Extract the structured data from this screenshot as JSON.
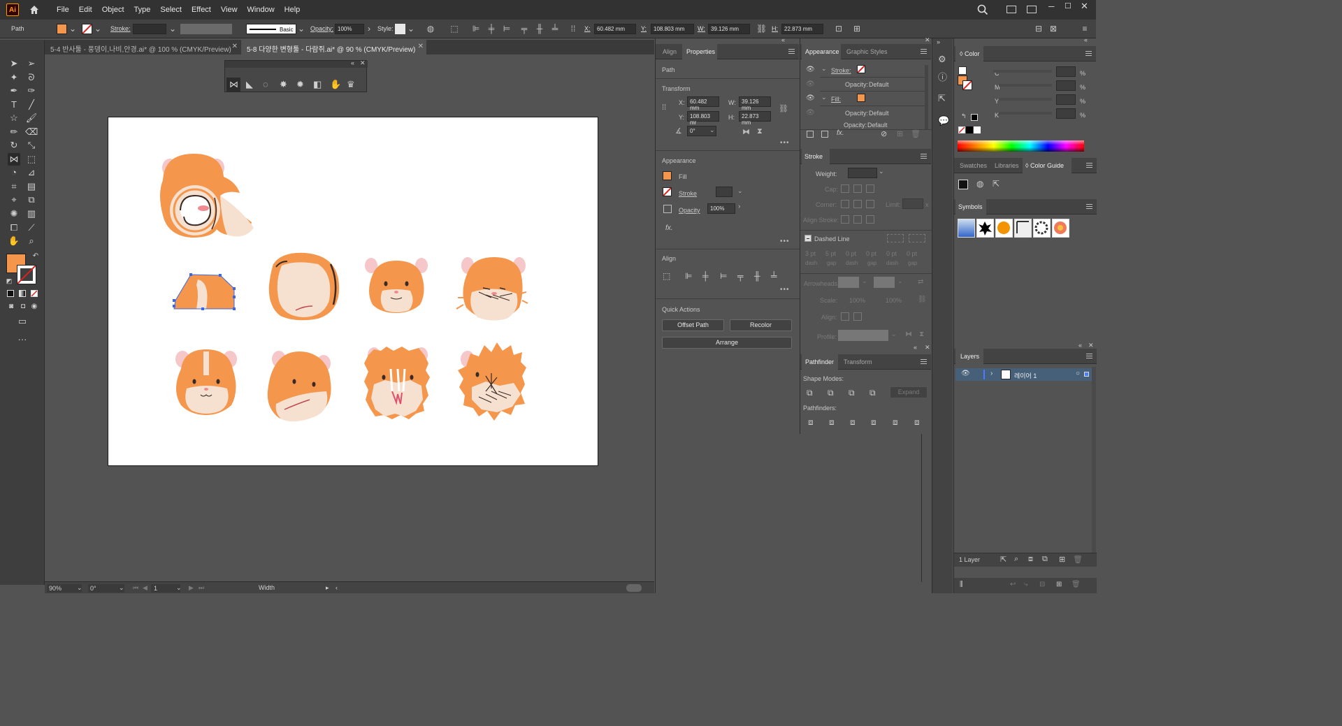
{
  "app": {
    "logo": "Ai"
  },
  "menu": [
    "File",
    "Edit",
    "Object",
    "Type",
    "Select",
    "Effect",
    "View",
    "Window",
    "Help"
  ],
  "control_bar": {
    "selection_type": "Path",
    "stroke_label": "Stroke:",
    "brush_label": "Basic",
    "opacity_label": "Opacity:",
    "opacity_value": "100%",
    "style_label": "Style:",
    "x_label": "X:",
    "x_value": "60.482 mm",
    "y_label": "Y:",
    "y_value": "108.803 mm",
    "w_label": "W:",
    "w_value": "39.126 mm",
    "h_label": "H:",
    "h_value": "22.873 mm"
  },
  "doc_tabs": [
    {
      "label": "5-4 반사툴 - 풍뎅이,나비,안경.ai* @ 100 % (CMYK/Preview)",
      "active": false
    },
    {
      "label": "5-8 다양한 변형툴 - 다람쥐.ai* @ 90 % (CMYK/Preview)",
      "active": true
    }
  ],
  "status_bar": {
    "zoom": "90%",
    "rotation": "0°",
    "artboard": "1",
    "tool_name": "Width"
  },
  "properties_panel": {
    "tabs": [
      "Align",
      "Properties"
    ],
    "section_path": "Path",
    "section_transform": "Transform",
    "x_label": "X:",
    "x_value": "60.482 mm",
    "y_label": "Y:",
    "y_value": "108.803 mr",
    "w_label": "W:",
    "w_value": "39.126 mm",
    "h_label": "H:",
    "h_value": "22.873 mm",
    "angle_value": "0°",
    "section_appearance": "Appearance",
    "fill_label": "Fill",
    "stroke_label": "Stroke",
    "opacity_label": "Opacity",
    "opacity_value": "100%",
    "fx_label": "fx.",
    "section_align": "Align",
    "section_quick_actions": "Quick Actions",
    "offset_path": "Offset Path",
    "recolor": "Recolor",
    "arrange": "Arrange"
  },
  "appearance_panel": {
    "tabs": [
      "Appearance",
      "Graphic Styles"
    ],
    "rows": [
      {
        "label": "Stroke:",
        "value": ""
      },
      {
        "label": "Opacity:",
        "value": "Default"
      },
      {
        "label": "Fill:",
        "value": ""
      },
      {
        "label": "Opacity:",
        "value": "Default"
      },
      {
        "label": "Opacity:",
        "value": "Default"
      }
    ],
    "fx_label": "fx."
  },
  "stroke_panel": {
    "title": "Stroke",
    "weight_label": "Weight:",
    "cap_label": "Cap:",
    "corner_label": "Corner:",
    "limit_label": "Limit:",
    "limit_unit": "x",
    "align_label": "Align Stroke:",
    "dashed_label": "Dashed Line",
    "dash_values": [
      "3 pt",
      "5 pt",
      "0 pt",
      "0 pt",
      "0 pt",
      "0 pt"
    ],
    "dash_labels": [
      "dash",
      "gap",
      "dash",
      "gap",
      "dash",
      "gap"
    ],
    "arrowheads_label": "Arrowheads:",
    "scale_label": "Scale:",
    "scale_values": [
      "100%",
      "100%"
    ],
    "align2_label": "Align:",
    "profile_label": "Profile:"
  },
  "pathfinder_panel": {
    "tabs": [
      "Pathfinder",
      "Transform"
    ],
    "shape_modes": "Shape Modes:",
    "expand": "Expand",
    "pathfinders": "Pathfinders:"
  },
  "color_panel": {
    "title": "Color",
    "channels": [
      "C",
      "M",
      "Y",
      "K"
    ],
    "unit": "%"
  },
  "swatches_panel": {
    "tabs": [
      "Swatches",
      "Libraries",
      "Color Guide"
    ]
  },
  "symbols_panel": {
    "title": "Symbols"
  },
  "layers_panel": {
    "title": "Layers",
    "layer_name": "레이어 1",
    "count": "1 Layer"
  },
  "colors": {
    "hamster_orange": "#f4964c",
    "hamster_cream": "#f6e0cf",
    "ear_pink": "#f5c7c9",
    "selection": "#3a67e8",
    "accent": "#ff9a00"
  }
}
